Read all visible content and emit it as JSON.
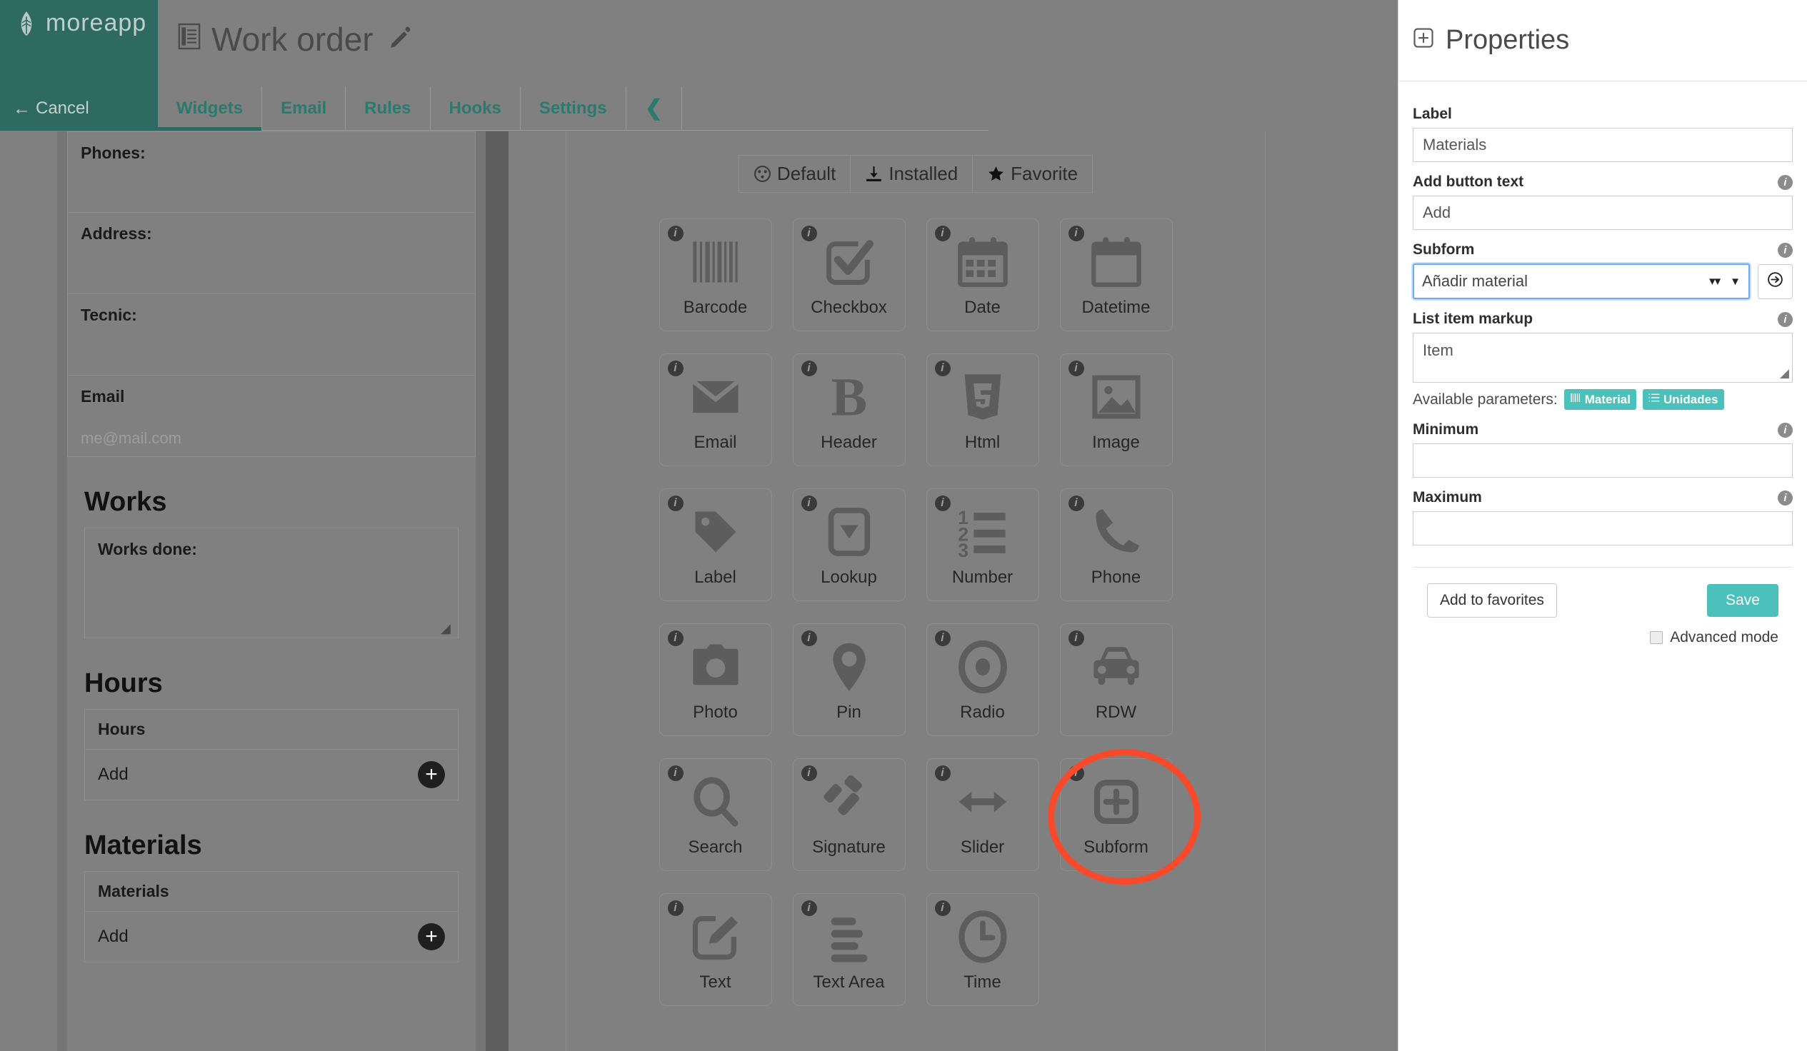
{
  "brand": {
    "logo_text": "moreapp",
    "logo_icon": "leaf-icon",
    "sidebar_color": "#2f6a62",
    "accent_color": "#4cc0bb",
    "highlight_color": "#f9492b"
  },
  "sidebar": {
    "cancel_label": "Cancel",
    "cancel_icon": "arrow-left-icon"
  },
  "header": {
    "title": "Work order",
    "doc_icon": "document-icon",
    "edit_icon": "pencil-icon"
  },
  "tabs": [
    {
      "label": "Widgets",
      "active": true
    },
    {
      "label": "Email",
      "active": false
    },
    {
      "label": "Rules",
      "active": false
    },
    {
      "label": "Hooks",
      "active": false
    },
    {
      "label": "Settings",
      "active": false
    }
  ],
  "tab_back_icon": "chevron-left-icon",
  "form_preview": {
    "fields": [
      {
        "label": "Phones:",
        "placeholder": ""
      },
      {
        "label": "Address:",
        "placeholder": ""
      },
      {
        "label": "Tecnic:",
        "placeholder": ""
      },
      {
        "label": "Email",
        "placeholder": "me@mail.com"
      }
    ],
    "sections": [
      {
        "heading": "Works",
        "type": "textarea",
        "field_label": "Works done:"
      },
      {
        "heading": "Hours",
        "type": "subform",
        "field_label": "Hours",
        "add_label": "Add",
        "add_icon": "plus-circle-icon"
      },
      {
        "heading": "Materials",
        "type": "subform",
        "field_label": "Materials",
        "add_label": "Add",
        "add_icon": "plus-circle-icon"
      }
    ]
  },
  "widgets_panel": {
    "filters": [
      {
        "label": "Default",
        "icon": "puzzle-icon",
        "active": false
      },
      {
        "label": "Installed",
        "icon": "download-icon",
        "active": false
      },
      {
        "label": "Favorite",
        "icon": "star-icon",
        "active": false
      }
    ],
    "info_badge": "i",
    "widgets": [
      {
        "label": "Barcode",
        "icon": "barcode-icon",
        "highlighted": false
      },
      {
        "label": "Checkbox",
        "icon": "checkbox-icon",
        "highlighted": false
      },
      {
        "label": "Date",
        "icon": "calendar-icon",
        "highlighted": false
      },
      {
        "label": "Datetime",
        "icon": "calendar-blank-icon",
        "highlighted": false
      },
      {
        "label": "Email",
        "icon": "envelope-icon",
        "highlighted": false
      },
      {
        "label": "Header",
        "icon": "bold-b-icon",
        "highlighted": false
      },
      {
        "label": "Html",
        "icon": "html5-icon",
        "highlighted": false
      },
      {
        "label": "Image",
        "icon": "image-icon",
        "highlighted": false
      },
      {
        "label": "Label",
        "icon": "tag-icon",
        "highlighted": false
      },
      {
        "label": "Lookup",
        "icon": "dropdown-icon",
        "highlighted": false
      },
      {
        "label": "Number",
        "icon": "numbered-list-icon",
        "highlighted": false
      },
      {
        "label": "Phone",
        "icon": "phone-icon",
        "highlighted": false
      },
      {
        "label": "Photo",
        "icon": "camera-icon",
        "highlighted": false
      },
      {
        "label": "Pin",
        "icon": "map-pin-icon",
        "highlighted": false
      },
      {
        "label": "Radio",
        "icon": "radio-icon",
        "highlighted": false
      },
      {
        "label": "RDW",
        "icon": "car-icon",
        "highlighted": false
      },
      {
        "label": "Search",
        "icon": "magnifier-icon",
        "highlighted": false
      },
      {
        "label": "Signature",
        "icon": "gavel-icon",
        "highlighted": false
      },
      {
        "label": "Slider",
        "icon": "arrows-horizontal-icon",
        "highlighted": false
      },
      {
        "label": "Subform",
        "icon": "plus-square-icon",
        "highlighted": true
      },
      {
        "label": "Text",
        "icon": "edit-box-icon",
        "highlighted": false
      },
      {
        "label": "Text Area",
        "icon": "lines-icon",
        "highlighted": false
      },
      {
        "label": "Time",
        "icon": "clock-icon",
        "highlighted": false
      }
    ]
  },
  "properties": {
    "title": "Properties",
    "title_icon": "plus-square-icon",
    "fields": {
      "label": {
        "label": "Label",
        "value": "Materials",
        "has_info": false
      },
      "add_button_text": {
        "label": "Add button text",
        "value": "Add",
        "has_info": true
      },
      "subform": {
        "label": "Subform",
        "value": "Añadir material",
        "has_info": true,
        "clear_icon": "clear-icon",
        "caret_icon": "chevron-down-icon",
        "goto_icon": "arrow-right-circle-icon",
        "focused": true
      },
      "list_item_markup": {
        "label": "List item markup",
        "value": "Item",
        "has_info": true
      },
      "minimum": {
        "label": "Minimum",
        "value": "",
        "has_info": true
      },
      "maximum": {
        "label": "Maximum",
        "value": "",
        "has_info": true
      }
    },
    "available_parameters_label": "Available parameters:",
    "available_parameters": [
      {
        "label": "Material",
        "icon": "barcode-icon"
      },
      {
        "label": "Unidades",
        "icon": "numbered-list-icon"
      }
    ],
    "footer": {
      "add_to_favorites_label": "Add to favorites",
      "save_label": "Save",
      "advanced_mode_label": "Advanced mode",
      "advanced_mode_checked": false
    }
  }
}
